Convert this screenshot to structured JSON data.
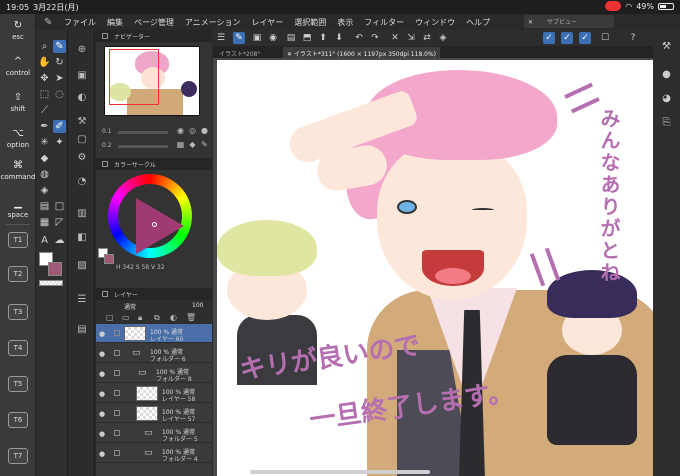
{
  "status": {
    "time": "19:05",
    "date": "3月22日(月)",
    "battery": "49%"
  },
  "menu": [
    "ファイル",
    "編集",
    "ページ管理",
    "アニメーション",
    "レイヤー",
    "選択範囲",
    "表示",
    "フィルター",
    "ウィンドウ",
    "ヘルプ"
  ],
  "subview": {
    "close": "✕",
    "label": "サブビュー"
  },
  "edge_bar": {
    "esc": "esc",
    "control": "control",
    "shift": "shift",
    "option": "option",
    "command": "command",
    "space": "space",
    "tabs": [
      "T1",
      "T2",
      "T3",
      "T4",
      "T5",
      "T6",
      "T7"
    ]
  },
  "panels": {
    "navigator": "ナビゲーター",
    "colorwheel": "カラーサークル",
    "color_values": "H 342   S 58   V 32",
    "layer": "レイヤー",
    "blend_mode": "通常",
    "opacity": "100",
    "brush_size": "0.1",
    "brush_label_1": "0.2",
    "layers": [
      {
        "line1": "100 % 通常",
        "line2": "レイヤー 60",
        "type": "layer",
        "selected": true
      },
      {
        "line1": "100 % 通常",
        "line2": "フォルダー 6",
        "type": "folder",
        "selected": false
      },
      {
        "line1": "100 % 通常",
        "line2": "フォルダー 8",
        "type": "folder",
        "selected": false
      },
      {
        "line1": "100 % 通常",
        "line2": "レイヤー 58",
        "type": "layer",
        "selected": false
      },
      {
        "line1": "100 % 通常",
        "line2": "レイヤー 57",
        "type": "layer",
        "selected": false
      },
      {
        "line1": "100 % 通常",
        "line2": "フォルダー 5",
        "type": "folder",
        "selected": false
      },
      {
        "line1": "100 % 通常",
        "line2": "フォルダー 4",
        "type": "folder",
        "selected": false
      }
    ]
  },
  "tabs": [
    {
      "label": "イラスト*208°",
      "active": false
    },
    {
      "label": "✕ イラスト*311° (1600 × 1197px 350dpi 118.0%)",
      "active": true
    }
  ],
  "canvas_text": {
    "top_right": "みんなありがとね",
    "line1": "キリが良いので",
    "line2": "一旦終了します。"
  },
  "colors": {
    "accent": "#3d6fb5",
    "handwriting": "#b56fb1",
    "hair": "#f3a8cb",
    "coat": "#d3aa7a"
  }
}
